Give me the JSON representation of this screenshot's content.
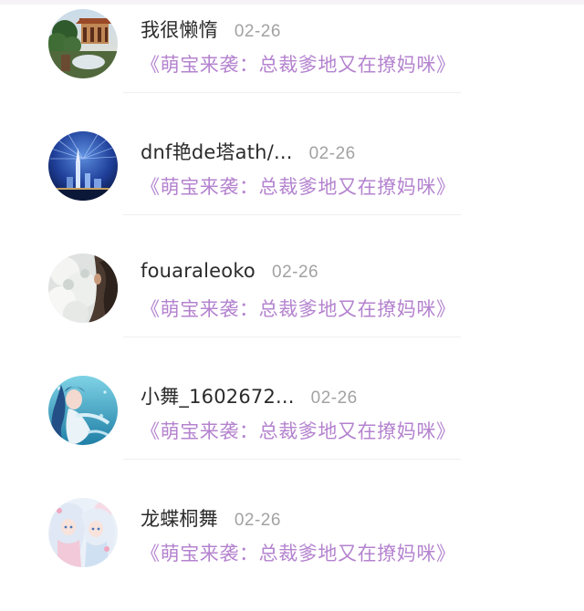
{
  "comments": [
    {
      "username": "我很懒惰",
      "date": "02-26",
      "title": "《萌宝来袭：总裁爹地又在撩妈咪》",
      "avatar_icon": "chinese-pavilion-landscape"
    },
    {
      "username": "dnf艳de塔ath/...",
      "date": "02-26",
      "title": "《萌宝来袭：总裁爹地又在撩妈咪》",
      "avatar_icon": "starry-night-city-tower"
    },
    {
      "username": "fouaraleoko",
      "date": "02-26",
      "title": "《萌宝来袭：总裁爹地又在撩妈咪》",
      "avatar_icon": "white-flowers-figure"
    },
    {
      "username": "小舞_1602672...",
      "date": "02-26",
      "title": "《萌宝来袭：总裁爹地又在撩妈咪》",
      "avatar_icon": "anime-girl-underwater"
    },
    {
      "username": "龙蝶桐舞",
      "date": "02-26",
      "title": "《萌宝来袭：总裁爹地又在撩妈咪》",
      "avatar_icon": "anime-girls-white-hair"
    }
  ],
  "colors": {
    "username": "#2b2b2b",
    "date": "#a2a2a2",
    "title_link": "#b483cf",
    "divider": "#f0eef1"
  }
}
